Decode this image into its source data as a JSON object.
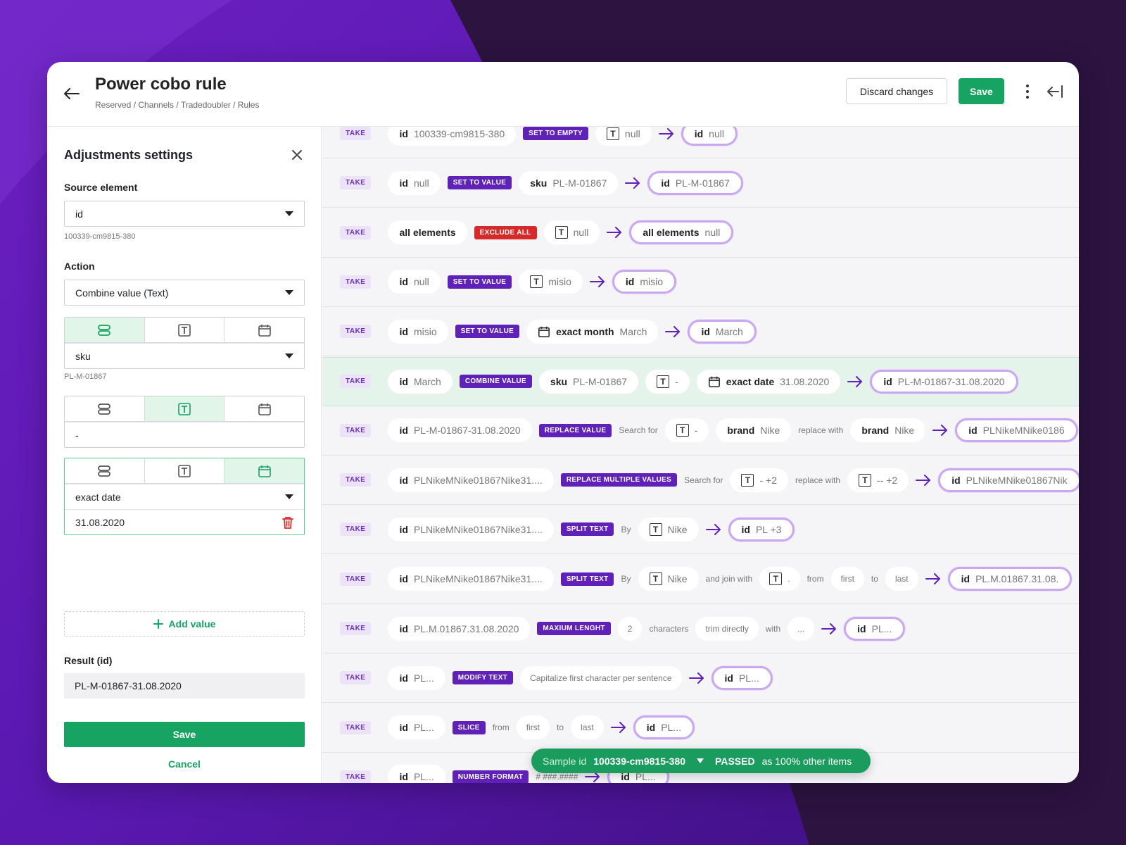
{
  "header": {
    "title": "Power cobo rule",
    "breadcrumb": "Reserved / Channels / Tradedoubler / Rules",
    "discard_label": "Discard changes",
    "save_label": "Save"
  },
  "sidebar": {
    "title": "Adjustments settings",
    "source_label": "Source element",
    "source_value": "id",
    "source_hint": "100339-cm9815-380",
    "action_label": "Action",
    "action_value": "Combine value (Text)",
    "group1": {
      "value": "sku",
      "hint": "PL-M-01867"
    },
    "group2": {
      "value": "-"
    },
    "group3": {
      "value": "exact date",
      "date": "31.08.2020"
    },
    "add_value": "Add value",
    "result_label": "Result (id)",
    "result_value": "PL-M-01867-31.08.2020",
    "save_label": "Save",
    "cancel_label": "Cancel"
  },
  "rows": [
    {
      "take": "TAKE",
      "src_key": "id",
      "src_val": "100339-cm9815-380",
      "action": "SET TO EMPTY",
      "arg_val": "null",
      "res_key": "id",
      "res_val": "null"
    },
    {
      "take": "TAKE",
      "src_key": "id",
      "src_val": "null",
      "action": "SET TO VALUE",
      "arg_key": "sku",
      "arg_val": "PL-M-01867",
      "res_key": "id",
      "res_val": "PL-M-01867"
    },
    {
      "take": "TAKE",
      "src_key": "all elements",
      "action": "EXCLUDE ALL",
      "arg_val": "null",
      "res_key": "all elements",
      "res_val": "null"
    },
    {
      "take": "TAKE",
      "src_key": "id",
      "src_val": "null",
      "action": "SET TO VALUE",
      "arg_val": "misio",
      "res_key": "id",
      "res_val": "misio"
    },
    {
      "take": "TAKE",
      "src_key": "id",
      "src_val": "misio",
      "action": "SET TO VALUE",
      "arg_key": "exact month",
      "arg_val": "March",
      "res_key": "id",
      "res_val": "March"
    },
    {
      "take": "TAKE",
      "src_key": "id",
      "src_val": "March",
      "action": "COMBINE VALUE",
      "arg_key": "sku",
      "arg_val": "PL-M-01867",
      "arg2_val": "-",
      "arg3_key": "exact date",
      "arg3_val": "31.08.2020",
      "res_key": "id",
      "res_val": "PL-M-01867-31.08.2020"
    },
    {
      "take": "TAKE",
      "src_key": "id",
      "src_val": "PL-M-01867-31.08.2020",
      "action": "REPLACE VALUE",
      "w1": "Search for",
      "arg_val": "-",
      "arg2_key": "brand",
      "arg2_val": "Nike",
      "w2": "replace with",
      "arg3_key": "brand",
      "arg3_val": "Nike",
      "res_key": "id",
      "res_val": "PLNikeMNike0186"
    },
    {
      "take": "TAKE",
      "src_key": "id",
      "src_val": "PLNikeMNike01867Nike31....",
      "action": "REPLACE MULTIPLE VALUES",
      "w1": "Search for",
      "arg_val": "- +2",
      "w2": "replace with",
      "arg2_val": "-- +2",
      "res_key": "id",
      "res_val": "PLNikeMNike01867Nik"
    },
    {
      "take": "TAKE",
      "src_key": "id",
      "src_val": "PLNikeMNike01867Nike31....",
      "action": "SPLIT TEXT",
      "w1": "By",
      "arg_val": "Nike",
      "res_key": "id",
      "res_val": "PL +3"
    },
    {
      "take": "TAKE",
      "src_key": "id",
      "src_val": "PLNikeMNike01867Nike31....",
      "action": "SPLIT TEXT",
      "w1": "By",
      "arg_val": "Nike",
      "w2": "and join with",
      "arg2_val": ".",
      "w3": "from",
      "arg3_val": "first",
      "w4": "to",
      "arg4_val": "last",
      "res_key": "id",
      "res_val": "PL.M.01867.31.08."
    },
    {
      "take": "TAKE",
      "src_key": "id",
      "src_val": "PL.M.01867.31.08.2020",
      "action": "MAXIUM LENGHT",
      "arg_val": "2",
      "w1": "characters",
      "arg2_val": "trim directly",
      "w2": "with",
      "arg3_val": "...",
      "res_key": "id",
      "res_val": "PL..."
    },
    {
      "take": "TAKE",
      "src_key": "id",
      "src_val": "PL...",
      "action": "MODIFY TEXT",
      "arg_val": "Capitalize first character per sentence",
      "res_key": "id",
      "res_val": "PL..."
    },
    {
      "take": "TAKE",
      "src_key": "id",
      "src_val": "PL...",
      "action": "SLICE",
      "w1": "from",
      "arg_val": "first",
      "w2": "to",
      "arg2_val": "last",
      "res_key": "id",
      "res_val": "PL..."
    },
    {
      "take": "TAKE",
      "src_key": "id",
      "src_val": "PL...",
      "action": "NUMBER FORMAT",
      "arg_val": "# ###.####",
      "res_key": "id",
      "res_val": "PL..."
    }
  ],
  "sample": {
    "label": "Sample id",
    "id": "100339-cm9815-380",
    "status": "PASSED",
    "status_suffix": "as 100% other items"
  },
  "colors": {
    "accent": "#17a361",
    "purple": "#6021b8",
    "red": "#d62a2a"
  }
}
